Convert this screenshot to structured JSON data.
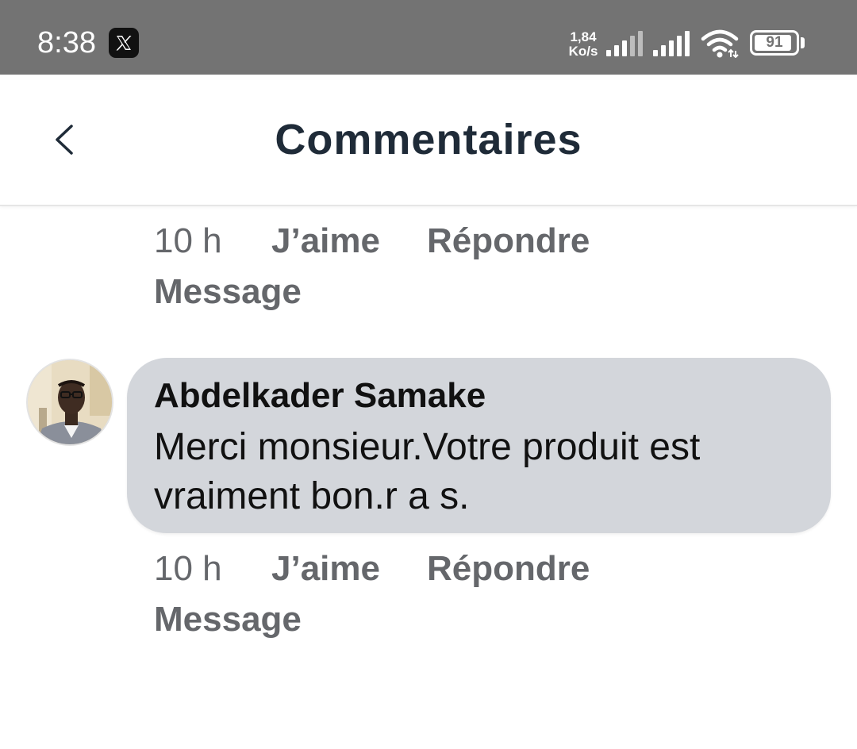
{
  "status_bar": {
    "time": "8:38",
    "app_icon": "x-app-icon",
    "net_speed_value": "1,84",
    "net_speed_unit": "Ko/s",
    "battery_level": 91,
    "battery_text": "91",
    "icons": [
      "signal-icon",
      "signal-icon",
      "wifi-icon",
      "battery-icon"
    ],
    "background_color": "#737373"
  },
  "header": {
    "back_icon": "chevron-left-icon",
    "title": "Commentaires"
  },
  "comments": [
    {
      "text": "",
      "time": "10 h",
      "like_label": "J’aime",
      "reply_label": "Répondre",
      "message_label": "Message"
    },
    {
      "author": "Abdelkader Samake",
      "text": "Merci monsieur.Votre produit est vraiment bon.r a s.",
      "time": "10 h",
      "like_label": "J’aime",
      "reply_label": "Répondre",
      "message_label": "Message"
    }
  ],
  "colors": {
    "bubble": "#d3d6db",
    "action_text": "#65676b",
    "title": "#1f2b38"
  }
}
